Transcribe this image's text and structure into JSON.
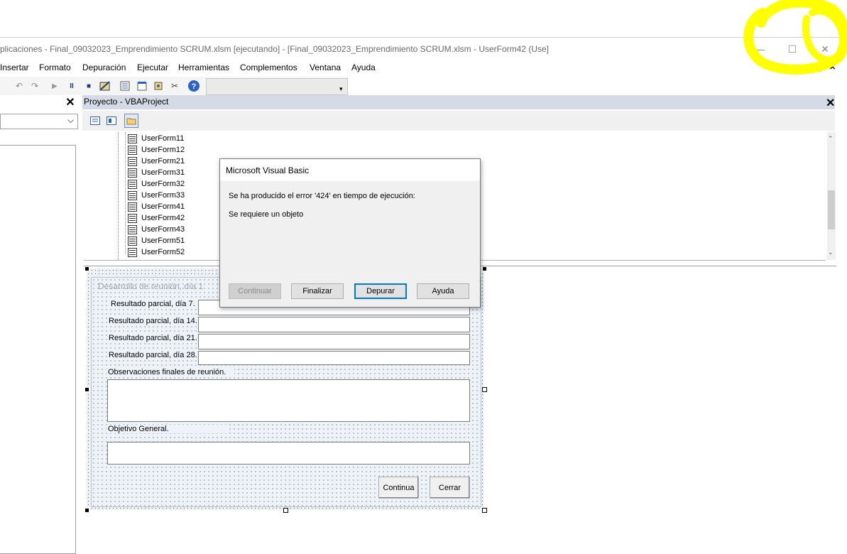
{
  "window": {
    "title": "plicaciones - Final_09032023_Emprendimiento SCRUM.xlsm [ejecutando] - [Final_09032023_Emprendimiento SCRUM.xlsm - UserForm42 (Use]",
    "controls": {
      "minimize": "—",
      "maximize": "☐",
      "close": "✕"
    },
    "mdi_controls": {
      "minimize": "_",
      "restore": "🗗",
      "close": "✕"
    }
  },
  "menu": {
    "items": [
      "Insertar",
      "Formato",
      "Depuración",
      "Ejecutar",
      "Herramientas",
      "Complementos",
      "Ventana",
      "Ayuda"
    ]
  },
  "toolbar": {
    "icons": [
      "undo-icon",
      "redo-icon",
      "run-icon",
      "pause-icon",
      "stop-icon",
      "design-mode-icon",
      "project-explorer-icon",
      "properties-icon",
      "object-browser-icon",
      "toolbox-icon",
      "help-icon"
    ]
  },
  "left_panel": {
    "close": "✕",
    "combo_arrow": "⌵"
  },
  "project": {
    "title": "Proyecto - VBAProject",
    "close": "✕",
    "tree": [
      "UserForm11",
      "UserForm12",
      "UserForm21",
      "UserForm31",
      "UserForm32",
      "UserForm33",
      "UserForm41",
      "UserForm42",
      "UserForm43",
      "UserForm51",
      "UserForm52"
    ]
  },
  "userform": {
    "caption": "Desarrollo de reunión, día 1",
    "labels": {
      "d7": "Resultado parcial, día 7.",
      "d14": "Resultado parcial, día 14.",
      "d21": "Resultado parcial, día 21.",
      "d28": "Resultado parcial, día 28.",
      "observaciones": "Observaciones finales de reunión.",
      "objetivo": "Objetivo General."
    },
    "buttons": {
      "continua": "Continua",
      "cerrar": "Cerrar"
    }
  },
  "dialog": {
    "title": "Microsoft Visual Basic",
    "message_line1": "Se ha producido el error '424' en tiempo de ejecución:",
    "message_line2": "Se requiere un objeto",
    "buttons": {
      "continuar": "Continuar",
      "finalizar": "Finalizar",
      "depurar": "Depurar",
      "ayuda": "Ayuda"
    }
  },
  "colors": {
    "project_header": "#d4dbe6",
    "highlight": "#ffff00",
    "focus_button_border": "#0078d7"
  }
}
